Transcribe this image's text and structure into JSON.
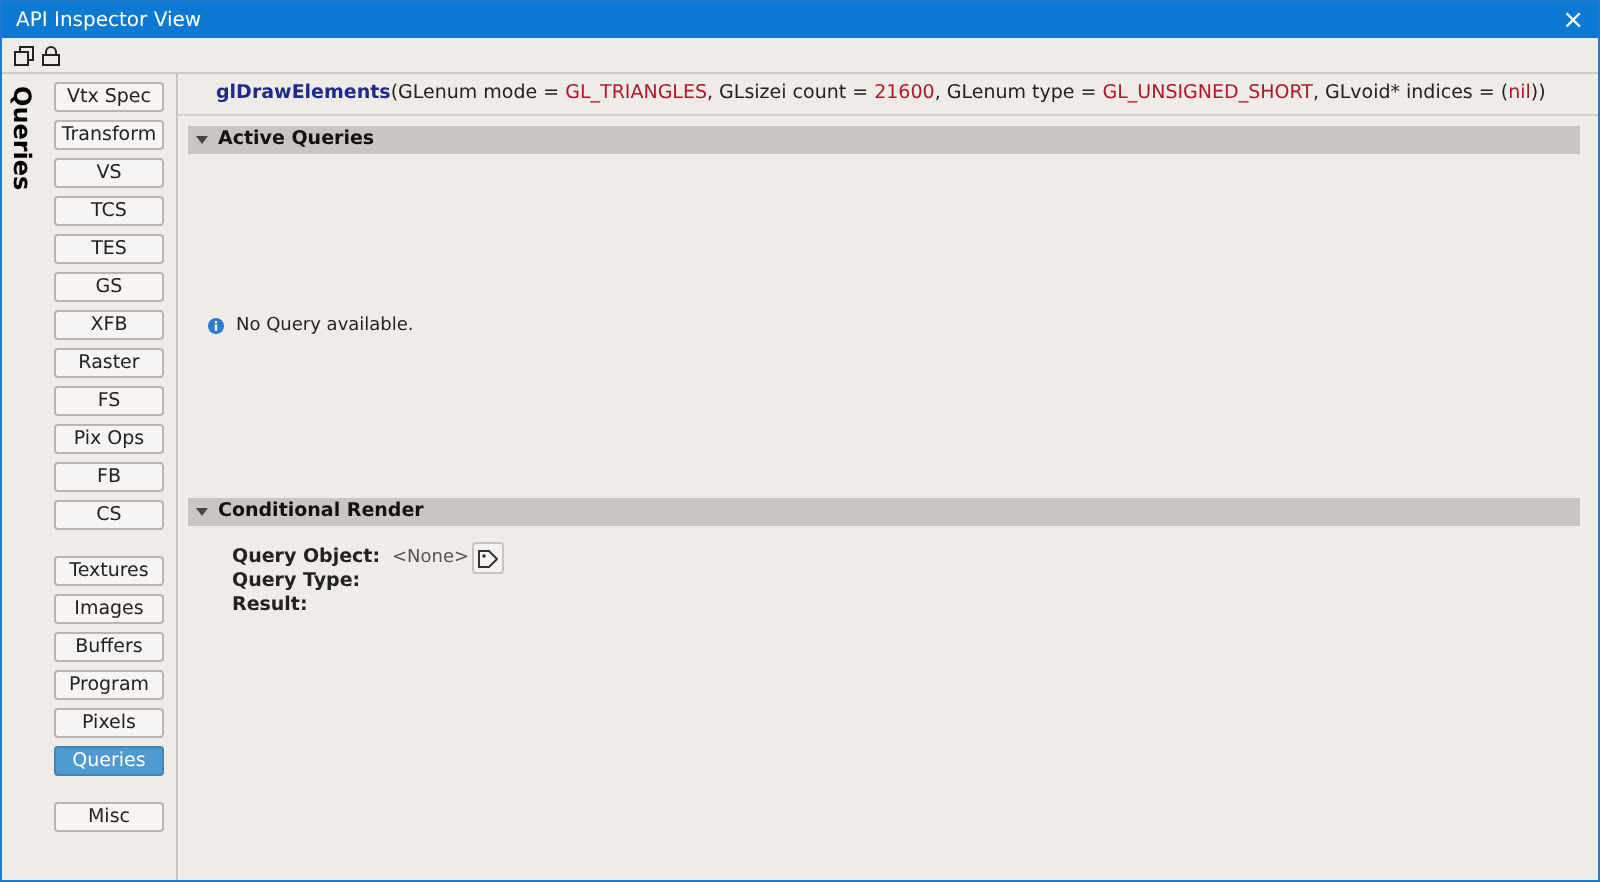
{
  "window": {
    "title": "API Inspector View",
    "close": "×"
  },
  "sidebar": {
    "title": "Queries",
    "groups": [
      {
        "items": [
          {
            "label": "Vtx Spec",
            "selected": false
          },
          {
            "label": "Transform",
            "selected": false
          },
          {
            "label": "VS",
            "selected": false
          },
          {
            "label": "TCS",
            "selected": false
          },
          {
            "label": "TES",
            "selected": false
          },
          {
            "label": "GS",
            "selected": false
          },
          {
            "label": "XFB",
            "selected": false
          },
          {
            "label": "Raster",
            "selected": false
          },
          {
            "label": "FS",
            "selected": false
          },
          {
            "label": "Pix Ops",
            "selected": false
          },
          {
            "label": "FB",
            "selected": false
          },
          {
            "label": "CS",
            "selected": false
          }
        ]
      },
      {
        "items": [
          {
            "label": "Textures",
            "selected": false
          },
          {
            "label": "Images",
            "selected": false
          },
          {
            "label": "Buffers",
            "selected": false
          },
          {
            "label": "Program",
            "selected": false
          },
          {
            "label": "Pixels",
            "selected": false
          },
          {
            "label": "Queries",
            "selected": true
          }
        ]
      },
      {
        "items": [
          {
            "label": "Misc",
            "selected": false
          }
        ]
      }
    ]
  },
  "call": [
    {
      "kind": "name",
      "text": "glDrawElements"
    },
    {
      "kind": "plain",
      "text": "(GLenum mode = "
    },
    {
      "kind": "value",
      "text": "GL_TRIANGLES"
    },
    {
      "kind": "plain",
      "text": ", GLsizei count = "
    },
    {
      "kind": "value",
      "text": "21600"
    },
    {
      "kind": "plain",
      "text": ", GLenum type = "
    },
    {
      "kind": "value",
      "text": "GL_UNSIGNED_SHORT"
    },
    {
      "kind": "plain",
      "text": ", GLvoid* indices = ("
    },
    {
      "kind": "value",
      "text": "nil"
    },
    {
      "kind": "plain",
      "text": "))"
    }
  ],
  "sections": [
    {
      "title": "Active Queries",
      "expanded": true,
      "kind": "message",
      "message": "No Query available."
    },
    {
      "title": "Conditional Render",
      "expanded": true,
      "kind": "fields",
      "fields": [
        {
          "label": "Query Object:",
          "value": "<None>",
          "has_button": true
        },
        {
          "label": "Query Type:"
        },
        {
          "label": "Result:"
        }
      ]
    }
  ]
}
